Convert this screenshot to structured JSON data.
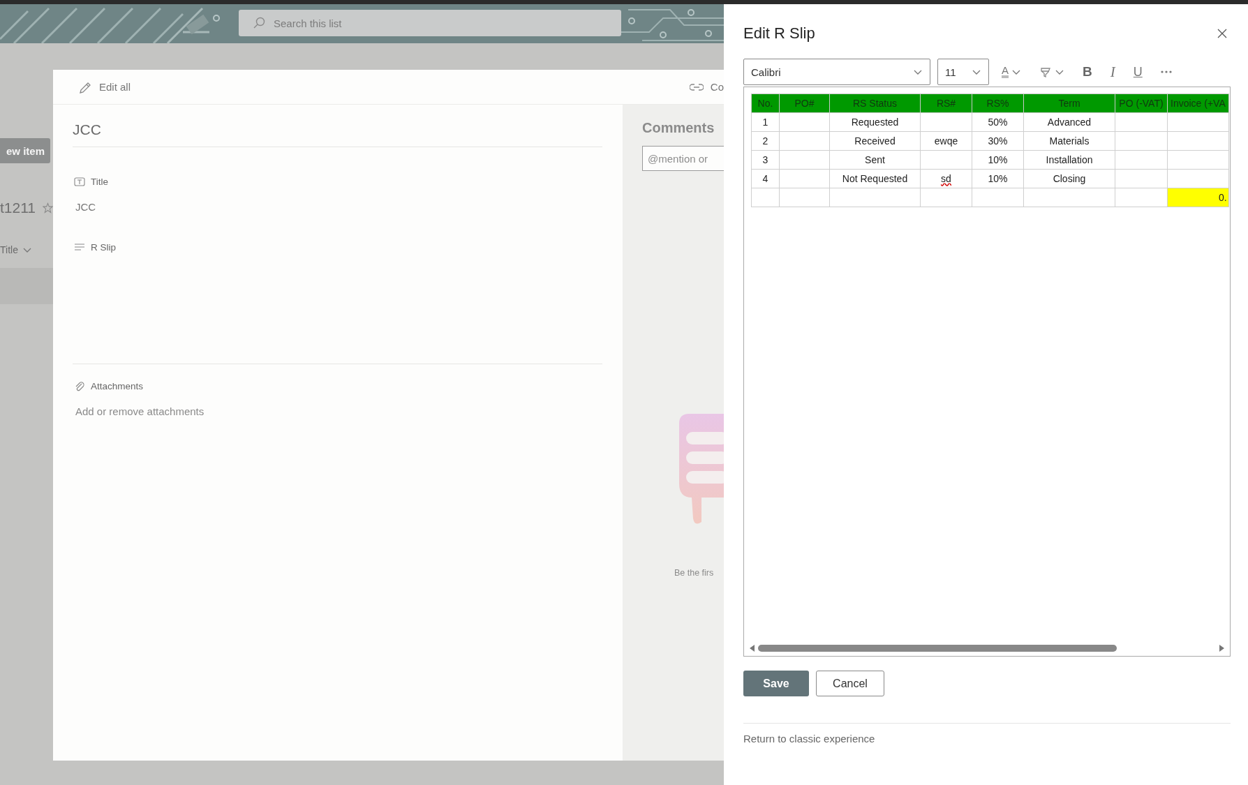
{
  "banner": {
    "search": {
      "placeholder": "Search this list"
    }
  },
  "list_page": {
    "new_item_button": "ew item",
    "list_title": "t1211",
    "column_header": "Title"
  },
  "item_dialog": {
    "toolbar": [
      {
        "kind": "edit",
        "label": "Edit all"
      },
      {
        "kind": "link",
        "label": "Co"
      }
    ],
    "item_title": "JCC",
    "fields": [
      {
        "kind": "text",
        "label": "Title",
        "value": "JCC"
      },
      {
        "kind": "rich_text",
        "label": "R Slip"
      }
    ],
    "attachments": {
      "label": "Attachments",
      "link": "Add or remove attachments"
    },
    "comments": {
      "heading": "Comments",
      "input": {
        "placeholder": "@mention or"
      },
      "empty_text": "Be the firs"
    }
  },
  "edit_panel": {
    "title": "Edit R Slip",
    "font": "Calibri",
    "font_size": "11",
    "format_buttons": [
      {
        "kind": "font_color",
        "label": "A"
      },
      {
        "kind": "highlight"
      },
      {
        "kind": "bold",
        "label": "B"
      },
      {
        "kind": "italic",
        "label": "I"
      },
      {
        "kind": "underline",
        "label": "U"
      },
      {
        "kind": "more"
      }
    ],
    "table": {
      "columns": [
        "No.",
        "PO#",
        "RS Status",
        "RS#",
        "RS%",
        "Term",
        "PO (-VAT)",
        "Invoice (+VA"
      ],
      "rows": [
        {
          "cells": [
            "1",
            "",
            "Requested",
            "",
            "50%",
            "Advanced",
            "",
            ""
          ]
        },
        {
          "cells": [
            "2",
            "",
            "Received",
            "ewqe",
            "30%",
            "Materials",
            "",
            ""
          ]
        },
        {
          "cells": [
            "3",
            "",
            "Sent",
            "",
            "10%",
            "Installation",
            "",
            ""
          ]
        },
        {
          "cells": [
            "4",
            "",
            "Not Requested",
            {
              "text": "sd",
              "misspelled": true
            },
            "10%",
            "Closing",
            "",
            ""
          ]
        },
        {
          "cells": [
            "",
            "",
            "",
            "",
            "",
            "",
            "",
            {
              "text": "0.",
              "highlighted": true
            }
          ]
        }
      ]
    },
    "buttons": [
      {
        "kind": "primary",
        "label": "Save"
      },
      {
        "kind": "secondary",
        "label": "Cancel"
      }
    ],
    "footer_link": "Return to classic experience"
  }
}
